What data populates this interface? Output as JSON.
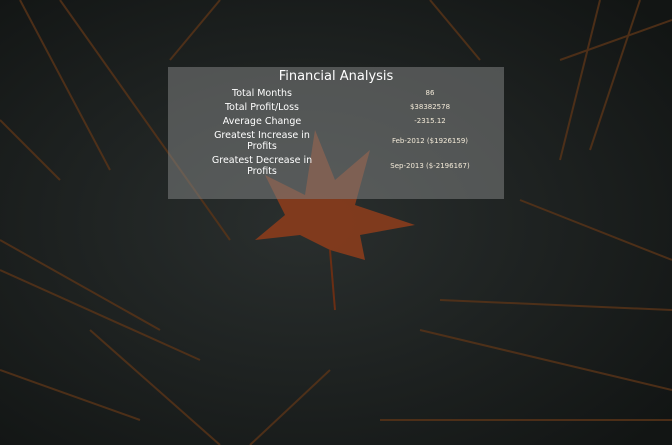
{
  "title": "Financial Analysis",
  "rows": [
    {
      "label": "Total Months",
      "value": "86"
    },
    {
      "label": "Total Profit/Loss",
      "value": "$38382578"
    },
    {
      "label": "Average Change",
      "value": "-2315.12"
    },
    {
      "label": "Greatest Increase in Profits",
      "value": "Feb-2012 ($1926159)"
    },
    {
      "label": "Greatest Decrease in Profits",
      "value": "Sep-2013 ($-2196167)"
    }
  ],
  "colors": {
    "background": "#161a19",
    "leaf": "#8a3c1c",
    "needles": "#5a3418"
  }
}
